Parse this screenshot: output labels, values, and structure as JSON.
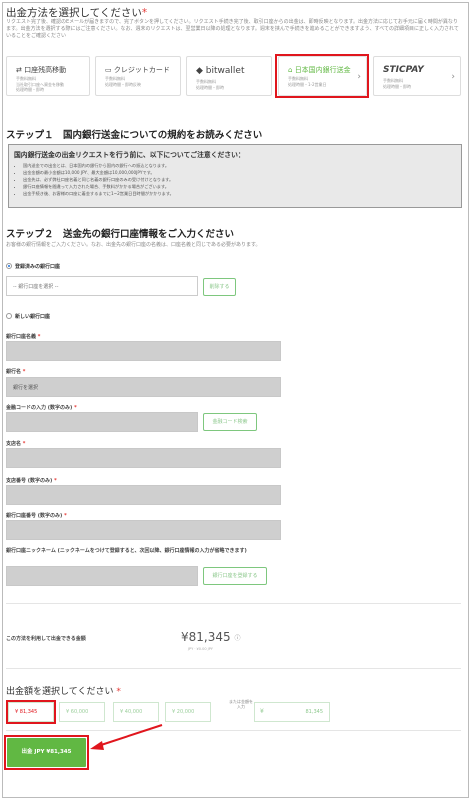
{
  "header": {
    "title": "出金方法を選択してください",
    "required_mark": "*",
    "intro": "リクエスト完了後、確認のEメールが届きますので、完了ボタンを押してください。リクエスト手続き完了後、取引口座からの出金は、即時反映となります。出金方法に応じてお手元に届く時間が異なります。出金方法を選択する際にはご注意ください。なお、週末のリクエストは、翌営業日以降の処理となります。週末を挟んで手続きを進めることができますよう、すべての詳細項目に正しく入力されていることをご確認ください"
  },
  "methods": [
    {
      "name": "口座残高移動",
      "desc": "手数料無料\n当社取引口座へ資金を移動\n処理時間・即時"
    },
    {
      "name": "クレジットカード",
      "desc": "手数料無料\n処理時間・即時反映"
    },
    {
      "name": "bitwallet",
      "desc": "手数料無料\n処理時間・即時"
    },
    {
      "name": "日本国内銀行送金",
      "desc": "手数料無料\n処理時間・1-2営業日"
    },
    {
      "name": "STICPAY",
      "desc": "手数料無料\n処理時間・即時"
    }
  ],
  "step1": {
    "title": "ステップ１　国内銀行送金についての規約をお読みください",
    "notice_head": "国内銀行送金の出金リクエストを行う前に、以下についてご注意ください：",
    "items": [
      "国内送金での出金とは、日本国内の銀行から国内の銀行への振込となります。",
      "出金金額の最小金額は10,000 JPY、最大金額は10,000,000JPYです。",
      "出金先は、必ず弊社口座名義と同じ名義の銀行口座のみの受け付けとなります。",
      "銀行口座情報を間違って入力された場合、手数料がかかる場合がございます。",
      "出金手続き後、お客様の口座に着金するまでに1~2営業日目時間がかかります。"
    ]
  },
  "step2": {
    "title": "ステップ２　送金先の銀行口座情報をご入力ください",
    "subtitle": "お客様の銀行情報をご入力ください。なお、出金先の銀行口座の名義は、口座名義と同じである必要があります。",
    "registered_label": "登録済みの銀行口座",
    "select_placeholder": "-- 銀行口座を選択 --",
    "delete_button": "削除する",
    "new_label": "新しい銀行口座",
    "fields": {
      "account_name": "銀行口座名義",
      "bank_name": "銀行名",
      "bank_select": "銀行を選択",
      "bank_code": "金融コードの入力 (数字のみ)",
      "bank_code_button": "金融コード検索",
      "branch_name": "支店名",
      "branch_number": "支店番号 (数字のみ)",
      "account_number": "銀行口座番号 (数字のみ)",
      "nickname": "銀行口座ニックネーム (ニックネームをつけて登録すると、次回以降、銀行口座情報の入力が省略できます)",
      "register_button": "銀行口座を登録する"
    },
    "required_mark": "*"
  },
  "available": {
    "label": "この方法を利用して出金できる金額",
    "amount": "¥81,345",
    "sub": "JPY · ¥0.00 JPY"
  },
  "amount": {
    "title": "出金額を選択してください",
    "required_mark": "*",
    "chips": [
      "¥ 81,345",
      "¥ 60,000",
      "¥ 40,000",
      "¥ 20,000"
    ],
    "selected_index": 0,
    "other_label": "または金額を入力",
    "other_yen": "¥",
    "other_value": "81,345"
  },
  "submit": {
    "label": "出金 JPY ¥81,345"
  },
  "colors": {
    "accent_green": "#61b843",
    "highlight_red": "#e0161d"
  }
}
